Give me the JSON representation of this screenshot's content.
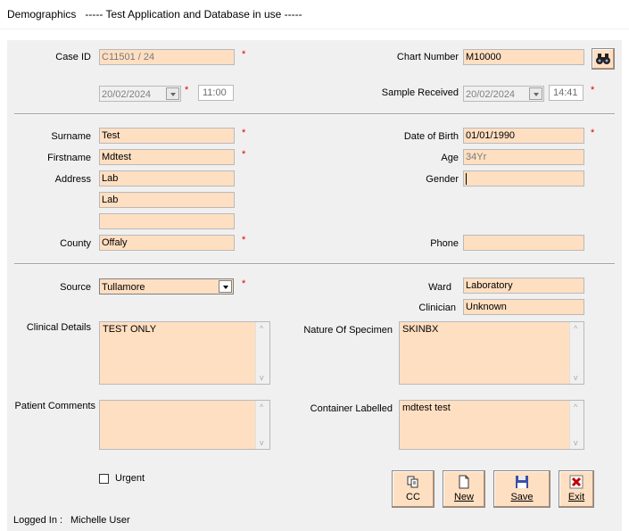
{
  "window": {
    "title": "Demographics",
    "subtitle": "----- Test Application and Database in use -----"
  },
  "case": {
    "case_id_label": "Case ID",
    "case_id": "C11501 / 24",
    "chart_number_label": "Chart Number",
    "chart_number": "M10000",
    "date": "20/02/2024",
    "time": "11:00",
    "sample_received_label": "Sample Received",
    "sample_received_date": "20/02/2024",
    "sample_received_time": "14:41"
  },
  "patient": {
    "surname_label": "Surname",
    "surname": "Test",
    "firstname_label": "Firstname",
    "firstname": "Mdtest",
    "address_label": "Address",
    "address1": "Lab",
    "address2": "Lab",
    "address3": "",
    "county_label": "County",
    "county": "Offaly",
    "dob_label": "Date of Birth",
    "dob": "01/01/1990",
    "age_label": "Age",
    "age": "34Yr",
    "gender_label": "Gender",
    "gender": "",
    "phone_label": "Phone",
    "phone": ""
  },
  "clinical": {
    "source_label": "Source",
    "source": "Tullamore",
    "ward_label": "Ward",
    "ward": "Laboratory",
    "clinician_label": "Clinician",
    "clinician": "Unknown",
    "clinical_details_label": "Clinical Details",
    "clinical_details": "TEST ONLY",
    "nature_label": "Nature Of Specimen",
    "nature": "SKINBX",
    "patient_comments_label": "Patient Comments",
    "patient_comments": "",
    "container_label": "Container Labelled",
    "container": "mdtest test",
    "urgent_label": "Urgent",
    "urgent": false
  },
  "required_mark": "*",
  "buttons": {
    "cc": "CC",
    "new": "New",
    "save": "Save",
    "exit": "Exit"
  },
  "status": {
    "logged_in_label": "Logged In :",
    "user": "Michelle User"
  },
  "colors": {
    "field_bg": "#ffdfc2",
    "panel_bg": "#f0f0f0",
    "required": "#e00000"
  }
}
